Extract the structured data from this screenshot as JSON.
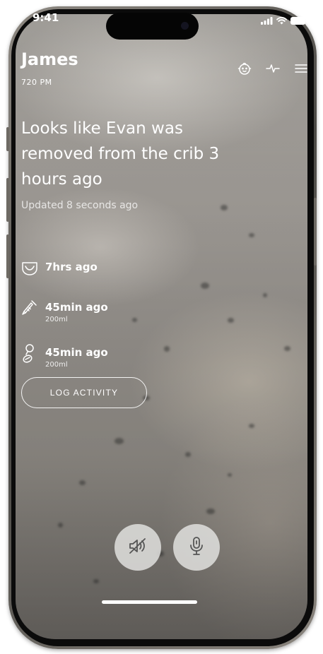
{
  "status_bar": {
    "time": "9:41"
  },
  "header": {
    "name": "James",
    "time": "720 PM",
    "icons": [
      "baby-face-icon",
      "activity-pulse-icon",
      "menu-icon"
    ]
  },
  "status": {
    "headline": "Looks like Evan was removed from the crib 3 hours ago",
    "updated": "Updated 8 seconds ago"
  },
  "activities": [
    {
      "icon": "diaper-icon",
      "label": "7hrs ago",
      "detail": ""
    },
    {
      "icon": "bottle-icon",
      "label": "45min ago",
      "detail": "200ml"
    },
    {
      "icon": "breast-pump-icon",
      "label": "45min ago",
      "detail": "200ml"
    }
  ],
  "actions": {
    "log_activity": "LOG ACTIVITY",
    "buttons": [
      "mute-speaker-icon",
      "microphone-icon"
    ]
  },
  "colors": {
    "text": "#ffffff",
    "button_bg": "#e1e1de",
    "icon_dark": "#555555"
  }
}
